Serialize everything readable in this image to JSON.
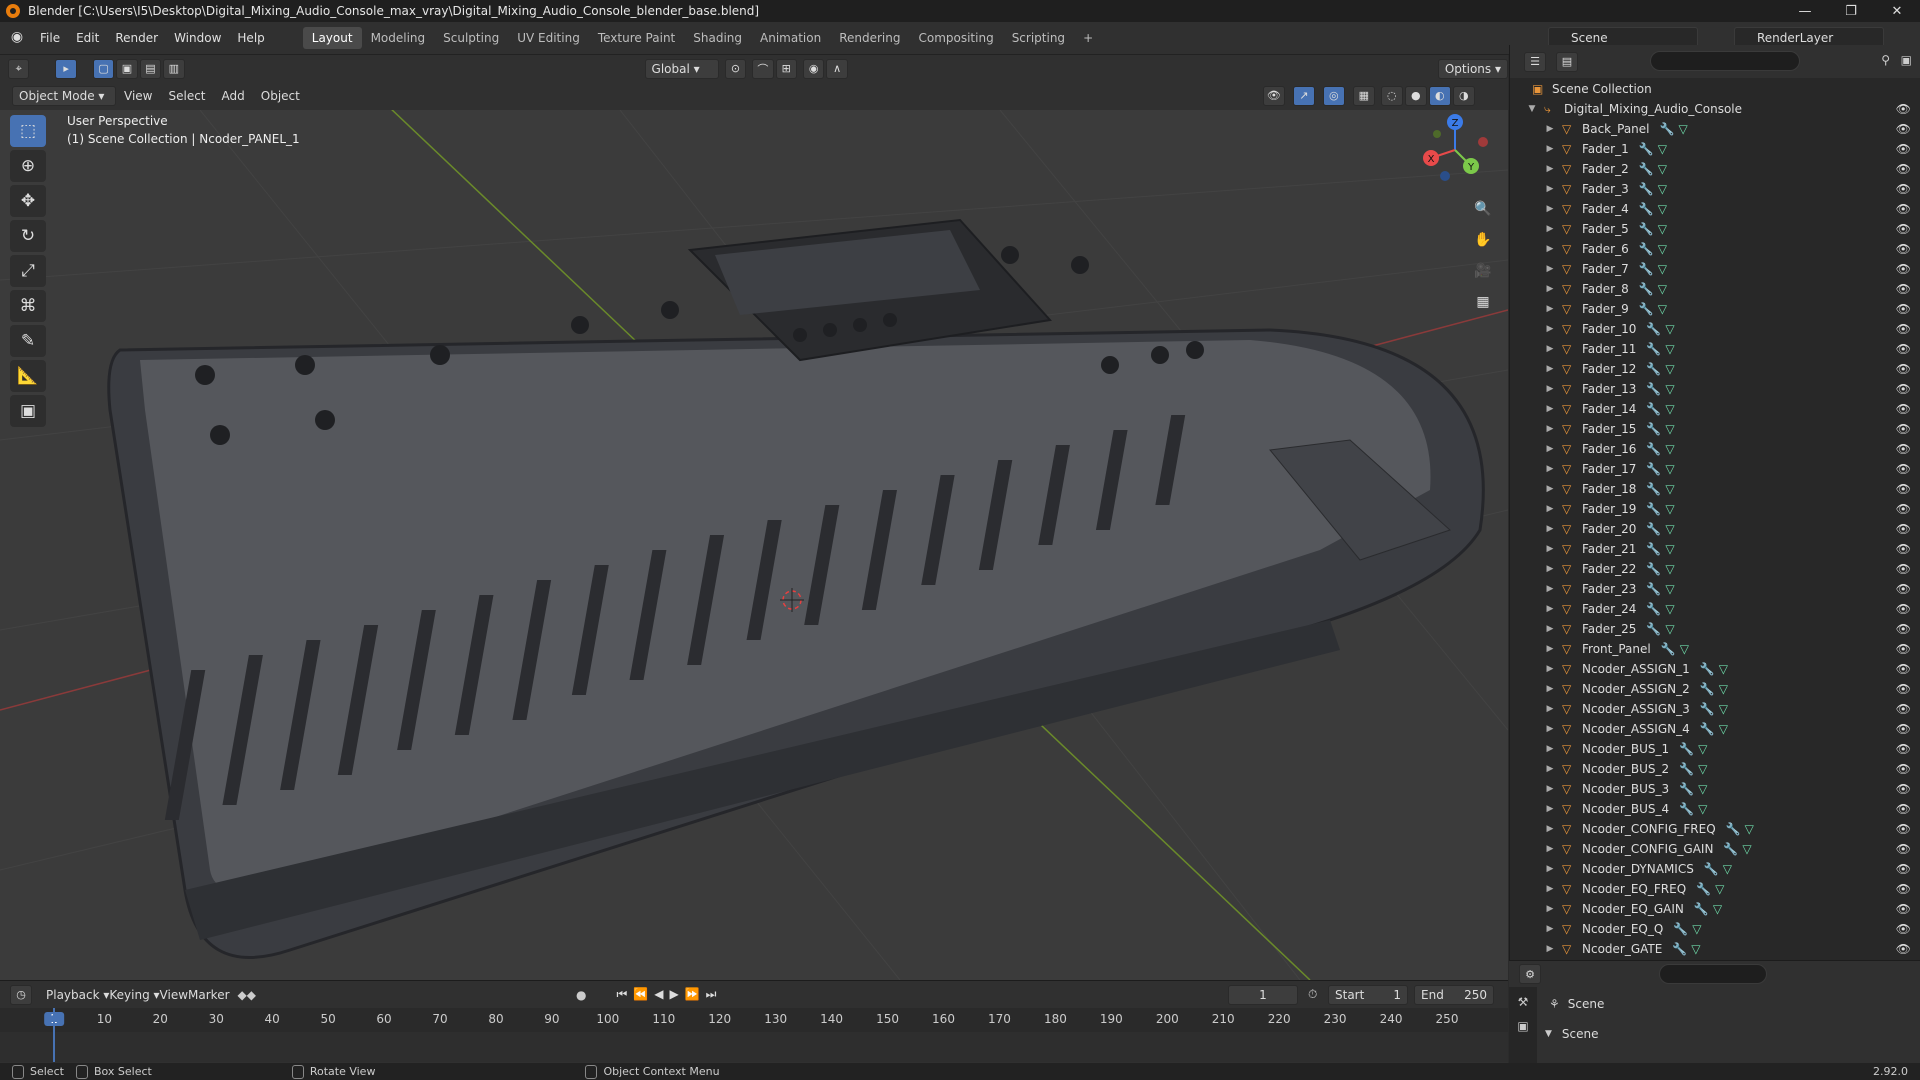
{
  "window": {
    "title": "Blender [C:\\Users\\I5\\Desktop\\Digital_Mixing_Audio_Console_max_vray\\Digital_Mixing_Audio_Console_blender_base.blend]",
    "minimize": "—",
    "maximize": "❐",
    "close": "✕"
  },
  "menu": {
    "items": [
      "File",
      "Edit",
      "Render",
      "Window",
      "Help"
    ],
    "workspaces": [
      "Layout",
      "Modeling",
      "Sculpting",
      "UV Editing",
      "Texture Paint",
      "Shading",
      "Animation",
      "Rendering",
      "Compositing",
      "Scripting",
      "+"
    ],
    "scene": "Scene",
    "view_layer": "RenderLayer"
  },
  "viewport_header": {
    "mode": "Object Mode",
    "menus": [
      "View",
      "Select",
      "Add",
      "Object"
    ],
    "orientation": "Global",
    "options": "Options"
  },
  "viewport": {
    "perspective": "User Perspective",
    "collection_info": "(1) Scene Collection | Ncoder_PANEL_1",
    "axes": {
      "x": "X",
      "y": "Y",
      "z": "Z"
    }
  },
  "toolbar_icons": [
    "select-box-icon",
    "cursor-icon",
    "move-icon",
    "rotate-icon",
    "scale-icon",
    "transform-icon",
    "annotate-icon",
    "measure-icon",
    "add-cube-icon"
  ],
  "outliner": {
    "search_placeholder": "",
    "root": "Scene Collection",
    "collection": "Digital_Mixing_Audio_Console",
    "objects": [
      "Back_Panel",
      "Fader_1",
      "Fader_2",
      "Fader_3",
      "Fader_4",
      "Fader_5",
      "Fader_6",
      "Fader_7",
      "Fader_8",
      "Fader_9",
      "Fader_10",
      "Fader_11",
      "Fader_12",
      "Fader_13",
      "Fader_14",
      "Fader_15",
      "Fader_16",
      "Fader_17",
      "Fader_18",
      "Fader_19",
      "Fader_20",
      "Fader_21",
      "Fader_22",
      "Fader_23",
      "Fader_24",
      "Fader_25",
      "Front_Panel",
      "Ncoder_ASSIGN_1",
      "Ncoder_ASSIGN_2",
      "Ncoder_ASSIGN_3",
      "Ncoder_ASSIGN_4",
      "Ncoder_BUS_1",
      "Ncoder_BUS_2",
      "Ncoder_BUS_3",
      "Ncoder_BUS_4",
      "Ncoder_CONFIG_FREQ",
      "Ncoder_CONFIG_GAIN",
      "Ncoder_DYNAMICS",
      "Ncoder_EQ_FREQ",
      "Ncoder_EQ_GAIN",
      "Ncoder_EQ_Q",
      "Ncoder_GATE"
    ]
  },
  "properties": {
    "scene_label": "Scene",
    "scene_section": "Scene"
  },
  "timeline": {
    "menus": [
      "Playback",
      "Keying",
      "View",
      "Marker"
    ],
    "current_frame": "1",
    "start_label": "Start",
    "start": "1",
    "end_label": "End",
    "end": "250",
    "ticks": [
      "1",
      "10",
      "20",
      "30",
      "40",
      "50",
      "60",
      "70",
      "80",
      "90",
      "100",
      "110",
      "120",
      "130",
      "140",
      "150",
      "160",
      "170",
      "180",
      "190",
      "200",
      "210",
      "220",
      "230",
      "240",
      "250"
    ]
  },
  "status": {
    "select": "Select",
    "box_select": "Box Select",
    "rotate_view": "Rotate View",
    "context_menu": "Object Context Menu",
    "version": "2.92.0"
  }
}
